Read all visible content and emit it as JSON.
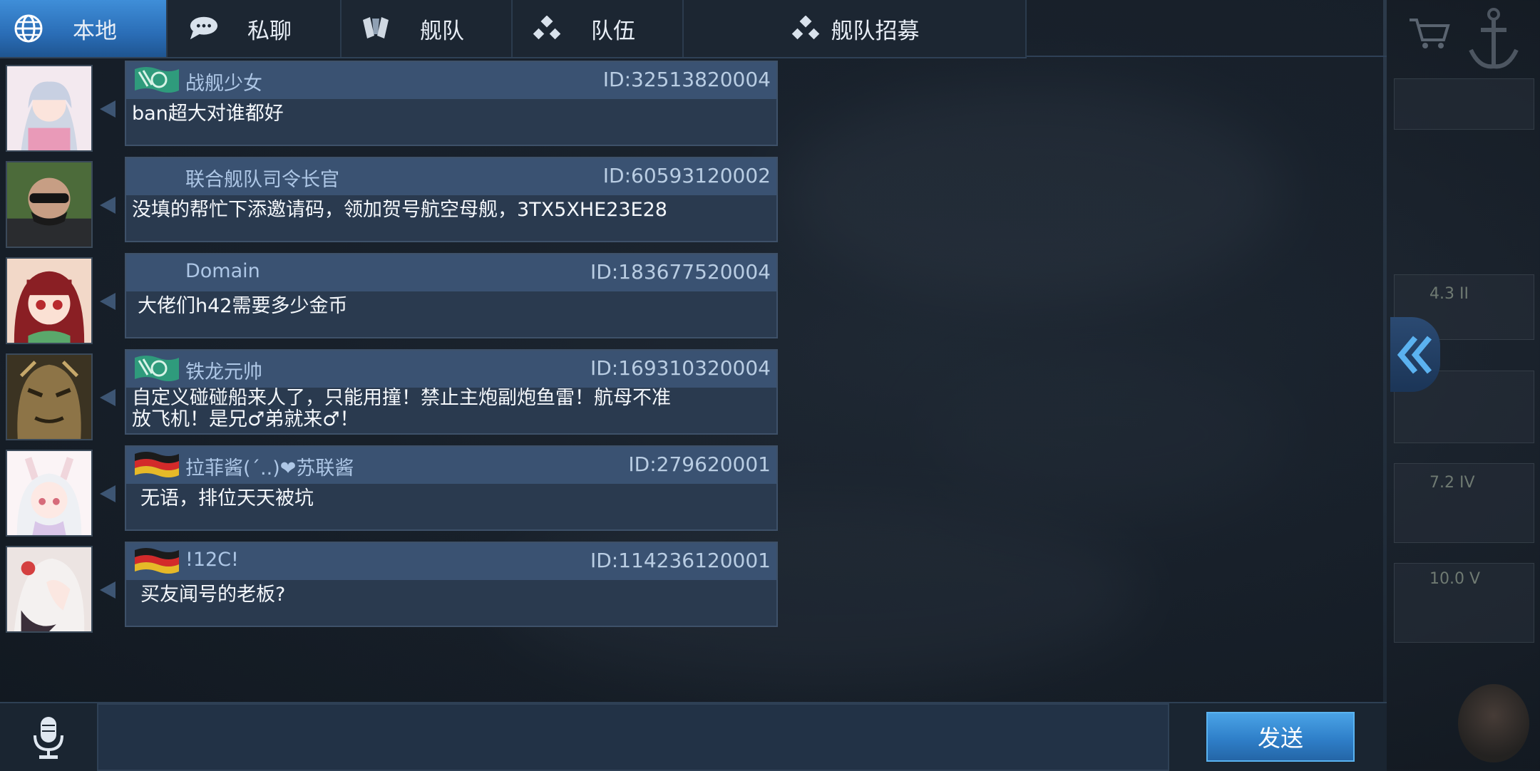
{
  "tabs": [
    {
      "label": "本地",
      "icon": "globe-icon",
      "active": true
    },
    {
      "label": "私聊",
      "icon": "chat-bubble-icon",
      "active": false
    },
    {
      "label": "舰队",
      "icon": "fleet-emblem-icon",
      "active": false
    },
    {
      "label": "队伍",
      "icon": "team-dots-icon",
      "active": false
    },
    {
      "label": "舰队招募",
      "icon": "team-dots-icon",
      "active": false
    }
  ],
  "messages": [
    {
      "username": "战舰少女",
      "id": "ID:32513820004",
      "text": "ban超大对谁都好",
      "flag": "green-emblem"
    },
    {
      "username": "联合舰队司令长官",
      "id": "ID:60593120002",
      "text": "没填的帮忙下添邀请码，领加贺号航空母舰，3TX5XHE23E28",
      "flag": "none"
    },
    {
      "username": "Domain",
      "id": "ID:183677520004",
      "text": "大佬们h42需要多少金币",
      "flag": "none"
    },
    {
      "username": "铁龙元帅",
      "id": "ID:169310320004",
      "text": "自定义碰碰船来人了，只能用撞！禁止主炮副炮鱼雷！航母不准\n 放飞机！是兄♂弟就来♂！",
      "flag": "green-emblem"
    },
    {
      "username": "拉菲酱(´..)❤苏联酱",
      "id": "ID:279620001",
      "text": "无语，排位天天被坑",
      "flag": "german-flag"
    },
    {
      "username": "!12C!",
      "id": "ID:114236120001",
      "text": "买友闻号的老板?",
      "flag": "german-flag"
    }
  ],
  "input": {
    "value": "",
    "placeholder": ""
  },
  "send_label": "发送",
  "decor": {
    "stat1": "4.3 II",
    "stat2": "7.2 IV",
    "stat3": "10.0 V"
  },
  "colors": {
    "active_tab": "#2f7fc9",
    "bubble_header": "#3a5272",
    "bubble_body": "#2a3a4f",
    "send_button": "#3a8fd6"
  }
}
